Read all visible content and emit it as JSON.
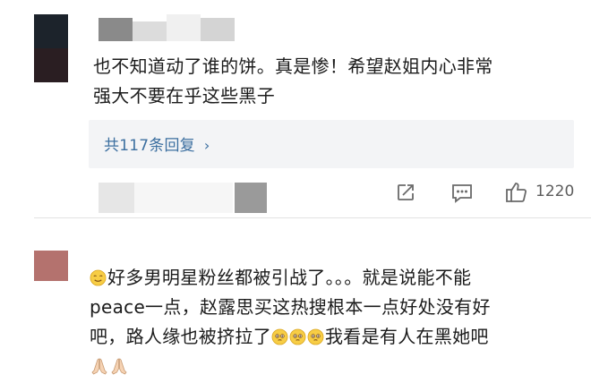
{
  "comment_top": {
    "text_line1": "也不知道动了谁的饼。真是惨！希望赵姐内心非常",
    "text_line2": "强大不要在乎这些黑子",
    "replies_label": "共117条回复",
    "like_count": "1220"
  },
  "comment_bottom": {
    "line1": "好多男明星粉丝都被引战了。。。就是说能不能",
    "line2": "peace一点，赵露思买这热搜根本一点好处没有好",
    "line3a": "吧，路人缘也被挤拉了",
    "line3b": "我看是有人在黑她吧"
  },
  "icons": {
    "share": "share-icon",
    "comment": "comment-icon",
    "like": "thumbs-up-icon",
    "emoji_smirk": "smirk-emoji-icon",
    "emoji_pleading": "pleading-face-emoji-icon",
    "emoji_pray": "folded-hands-emoji-icon"
  },
  "colors": {
    "link": "#3c6fa0",
    "reply_bg": "#f3f4f6",
    "text": "#1b1b1b",
    "meta": "#5c5c5c"
  }
}
